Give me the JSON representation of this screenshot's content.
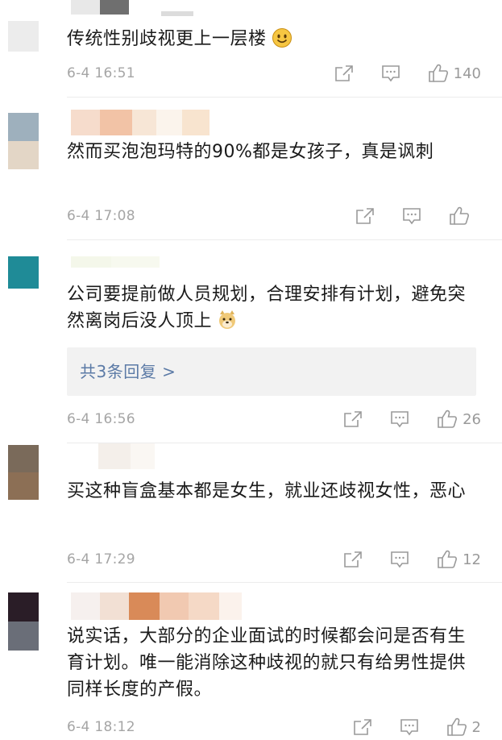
{
  "comments": [
    {
      "text": "传统性别歧视更上一层楼",
      "emoji": "smile",
      "time": "6-4 16:51",
      "likes": "140",
      "avatar_colors": [
        "#ececec",
        "#ececec"
      ]
    },
    {
      "text": "然而买泡泡玛特的90%都是女孩子，真是讽刺",
      "emoji": "",
      "time": "6-4 17:08",
      "likes": "",
      "avatar_colors": [
        "#9eb0bd",
        "#e3d6c6"
      ]
    },
    {
      "text": "公司要提前做人员规划，合理安排有计划，避免突然离岗后没人顶上",
      "emoji": "doge",
      "time": "6-4 16:56",
      "likes": "26",
      "avatar_colors": [
        "#1f8b97",
        "#1f8b97"
      ],
      "replies_label": "共3条回复 >"
    },
    {
      "text": "买这种盲盒基本都是女生，就业还歧视女性，恶心",
      "emoji": "",
      "time": "6-4 17:29",
      "likes": "12",
      "avatar_colors": [
        "#7a6a5a",
        "#8c6f55"
      ]
    },
    {
      "text": "说实话，大部分的企业面试的时候都会问是否有生育计划。唯一能消除这种歧视的就只有给男性提供同样长度的产假。",
      "emoji": "",
      "time": "6-4 18:12",
      "likes": "2",
      "avatar_colors": [
        "#2a1d27",
        "#6a6e78"
      ]
    }
  ],
  "colors": {
    "time": "#a5a5a5",
    "icon": "#9a9a9a",
    "link": "#5b7aa6",
    "reply_bg": "#f2f2f2"
  },
  "icons": [
    "share-icon",
    "comment-icon",
    "like-icon"
  ]
}
